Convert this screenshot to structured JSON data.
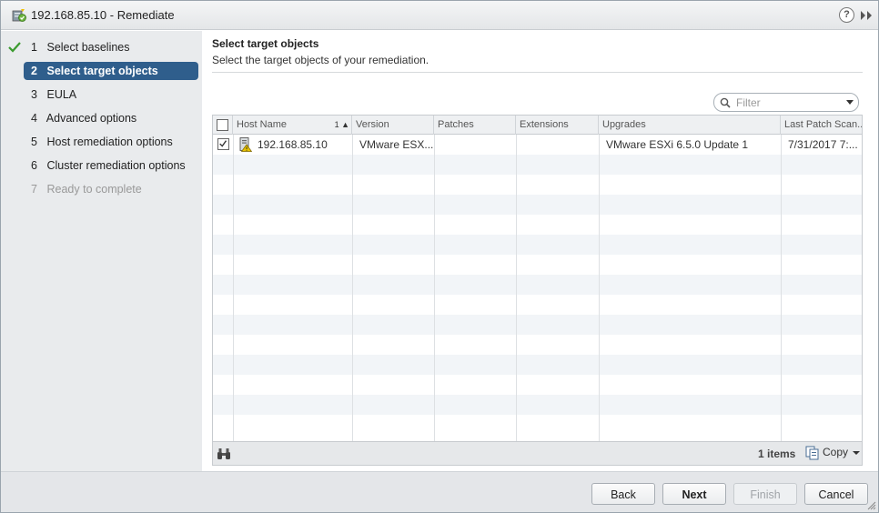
{
  "window": {
    "title": "192.168.85.10 - Remediate",
    "help_glyph": "?"
  },
  "nav": {
    "steps": [
      {
        "num": "1",
        "label": "Select baselines",
        "state": "completed"
      },
      {
        "num": "2",
        "label": "Select target objects",
        "state": "active"
      },
      {
        "num": "3",
        "label": "EULA",
        "state": "pending"
      },
      {
        "num": "4",
        "label": "Advanced options",
        "state": "pending"
      },
      {
        "num": "5",
        "label": "Host remediation options",
        "state": "pending"
      },
      {
        "num": "6",
        "label": "Cluster remediation options",
        "state": "pending"
      },
      {
        "num": "7",
        "label": "Ready to complete",
        "state": "disabled"
      }
    ]
  },
  "main": {
    "title": "Select target objects",
    "subtitle": "Select the target objects of your remediation."
  },
  "filter": {
    "placeholder": "Filter",
    "value": ""
  },
  "grid": {
    "columns": [
      {
        "label": "Host Name",
        "sort": "1 ▲"
      },
      {
        "label": "Version"
      },
      {
        "label": "Patches"
      },
      {
        "label": "Extensions"
      },
      {
        "label": "Upgrades"
      },
      {
        "label": "Last Patch Scan..."
      }
    ],
    "rows": [
      {
        "checked": true,
        "host_icon": "host-warning-icon",
        "host_name": "192.168.85.10",
        "version": "VMware ESX...",
        "patches": "",
        "extensions": "",
        "upgrades": "VMware ESXi 6.5.0 Update 1",
        "last_patch_scan": "7/31/2017 7:..."
      }
    ],
    "footer": {
      "count": "1 items",
      "copy_label": "Copy"
    }
  },
  "buttons": {
    "back": "Back",
    "next": "Next",
    "finish": "Finish",
    "cancel": "Cancel"
  },
  "colors": {
    "active_step": "#2f5e8c",
    "check": "#3a9a2e",
    "warning": "#e8c200"
  }
}
